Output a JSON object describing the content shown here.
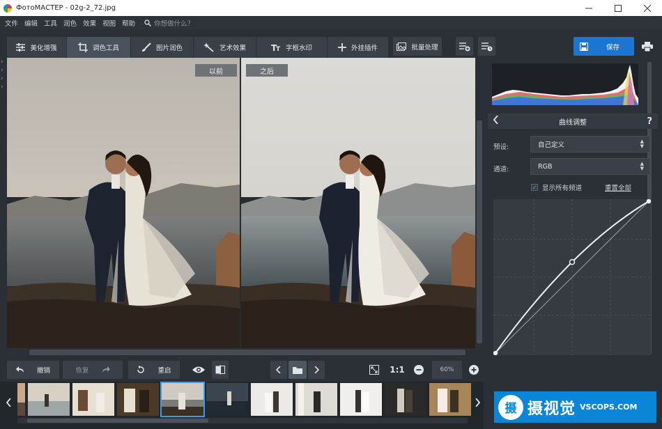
{
  "window": {
    "title": "ФотоМАСТЕР - 02g-2_72.jpg"
  },
  "menu": {
    "items": [
      "文件",
      "编辑",
      "工具",
      "润色",
      "效果",
      "视图",
      "帮助"
    ],
    "search_placeholder": "你想做什么？"
  },
  "toolbar": {
    "tabs": [
      {
        "label": "美化增强",
        "icon": "sliders-icon",
        "active": false
      },
      {
        "label": "调色工具",
        "icon": "crop-icon",
        "active": true
      },
      {
        "label": "图片润色",
        "icon": "brush-icon",
        "active": false
      },
      {
        "label": "艺术效果",
        "icon": "magic-wand-icon",
        "active": false
      },
      {
        "label": "字框水印",
        "icon": "text-icon",
        "active": false
      },
      {
        "label": "外挂插件",
        "icon": "plus-icon",
        "active": false
      }
    ],
    "batch_label": "批量处理",
    "save_label": "保存"
  },
  "preview": {
    "before_label": "以前",
    "after_label": "之后"
  },
  "bottom": {
    "undo_label": "撤销",
    "redo_label": "恢复",
    "reset_label": "重启",
    "ratio_label": "1:1",
    "zoom_value": "60%"
  },
  "curves": {
    "title": "曲线调整",
    "preset_label": "预设:",
    "preset_value": "自己定义",
    "channel_label": "通道:",
    "channel_value": "RGB",
    "show_all_label": "显示所有频道",
    "show_all_checked": true,
    "reset_all_label": "重置全部",
    "points": [
      [
        0,
        0
      ],
      [
        0.5,
        0.6
      ],
      [
        1,
        1
      ]
    ]
  },
  "watermark": {
    "seal": "摄",
    "cn": "摄视觉",
    "en": "VSCOPS.COM"
  },
  "colors": {
    "accent": "#1976d2",
    "selection": "#3d9be9",
    "panel": "#2b3036"
  }
}
